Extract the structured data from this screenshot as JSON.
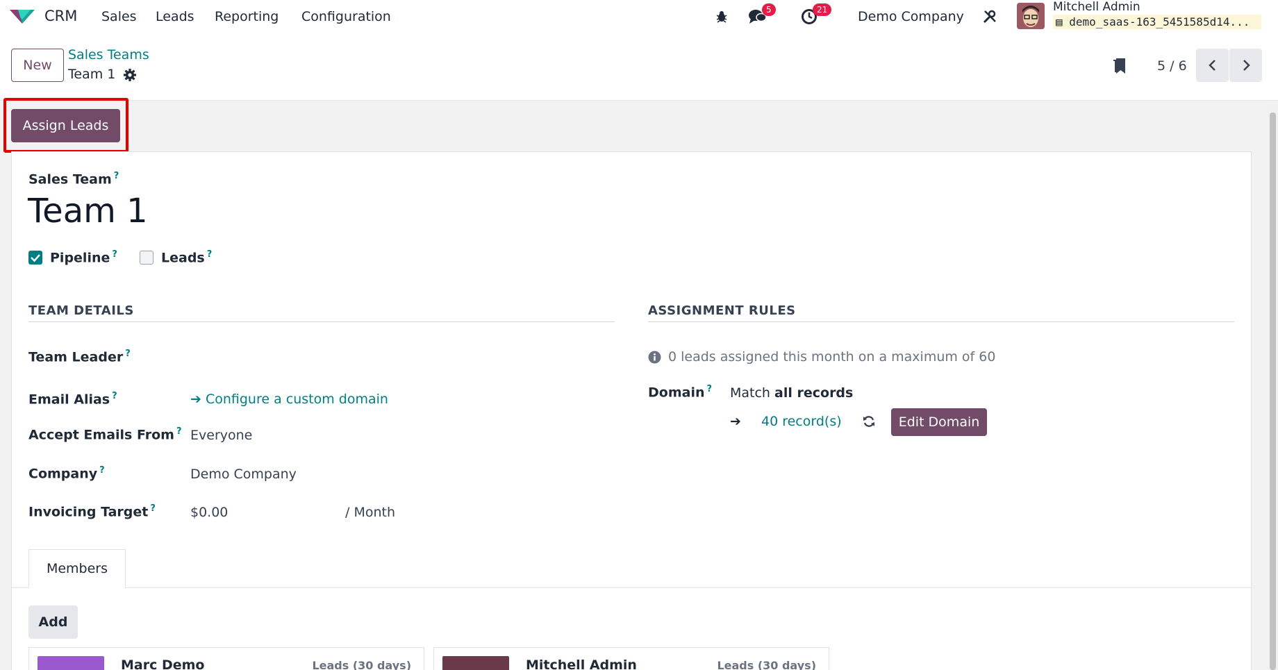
{
  "app": {
    "name": "CRM"
  },
  "menu": [
    "Sales",
    "Leads",
    "Reporting",
    "Configuration"
  ],
  "systray": {
    "messages_count": "5",
    "activities_count": "21",
    "company": "Demo Company",
    "user_name": "Mitchell Admin",
    "database": "demo_saas-163_5451585d14..."
  },
  "control": {
    "new_label": "New",
    "breadcrumb_parent": "Sales Teams",
    "breadcrumb_current": "Team 1",
    "pager": "5 / 6"
  },
  "actions": {
    "assign_leads": "Assign Leads"
  },
  "form": {
    "team_label": "Sales Team",
    "team_name": "Team 1",
    "pipeline_label": "Pipeline",
    "pipeline_checked": true,
    "leads_label": "Leads",
    "leads_checked": false,
    "team_details_title": "TEAM DETAILS",
    "assignment_rules_title": "ASSIGNMENT RULES",
    "team_leader_label": "Team Leader",
    "email_alias_label": "Email Alias",
    "email_alias_link": "Configure a custom domain",
    "accept_emails_label": "Accept Emails From",
    "accept_emails_value": "Everyone",
    "company_label": "Company",
    "company_value": "Demo Company",
    "invoicing_label": "Invoicing Target",
    "invoicing_value": "$0.00",
    "invoicing_unit": "/ Month",
    "assigned_info": "0 leads assigned this month on a maximum of 60",
    "domain_label": "Domain",
    "domain_match_prefix": "Match",
    "domain_match_bold": "all records",
    "records_link": "40 record(s)",
    "edit_domain": "Edit Domain"
  },
  "tabs": {
    "members": "Members"
  },
  "members": {
    "add_label": "Add",
    "items": [
      {
        "name": "Marc Demo",
        "meta": "Leads (30 days)"
      },
      {
        "name": "Mitchell Admin",
        "meta": "Leads (30 days)"
      }
    ]
  },
  "colors": {
    "primary": "#714b67",
    "link": "#017e84",
    "badge": "#e11d48",
    "highlight": "#e60000"
  }
}
